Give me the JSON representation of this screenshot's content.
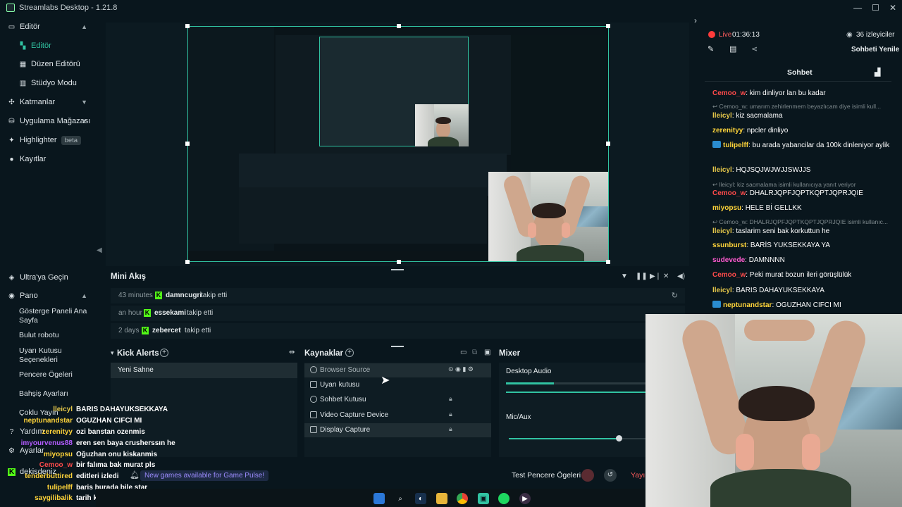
{
  "titlebar": {
    "title": "Streamlabs Desktop - 1.21.8",
    "minimize": "—",
    "maximize": "☐",
    "close": "✕"
  },
  "sidebar": {
    "editor_group": "Editör",
    "editor_items": [
      "Editör",
      "Düzen Editörü",
      "Stüdyo Modu"
    ],
    "layers": "Katmanlar",
    "store": "Uygulama Mağazası",
    "highlighter": "Highlighter",
    "highlighter_badge": "beta",
    "recordings": "Kayıtlar",
    "ultra": "Ultra'ya Geçin",
    "dashboard": "Pano",
    "dashboard_items": [
      "Gösterge Paneli Ana Sayfa",
      "Bulut robotu",
      "Uyarı Kutusu Seçenekleri",
      "Pencere Ögeleri",
      "Bahşiş Ayarları",
      "Çoklu Yayın"
    ],
    "help": "Yardım",
    "settings": "Ayarlar",
    "user": "dekisdeniz"
  },
  "chat": {
    "live_label": "Live",
    "live_time": "01:36:13",
    "viewers": "36 izleyiciler",
    "refresh_label": "Sohbeti Yenile",
    "header": "Sohbet",
    "messages": [
      {
        "user": "Cemoo_w",
        "color": "#ff4b4b",
        "text": "kim dinliyor lan bu kadar",
        "badge": false,
        "muted": false
      },
      {
        "user": "",
        "color": "#7f8a8e",
        "text": "Cemoo_w: umarım zehirlenmem beyazlıcam diye isimli kull...",
        "badge": false,
        "muted": true
      },
      {
        "user": "lleicyl",
        "color": "#e6c84a",
        "text": "kiz sacmalama",
        "badge": false,
        "muted": false
      },
      {
        "user": "zerenityy",
        "color": "#ffd43a",
        "text": "npcler dinliyo",
        "badge": false,
        "muted": false
      },
      {
        "user": "tulipelff",
        "color": "#ffd43a",
        "text": "bu arada yabancilar da 100k dinleniyor aylik",
        "badge": true,
        "muted": false
      },
      {
        "user": "lleicyl",
        "color": "#e6c84a",
        "text": "HQJSQJWJWJJSWJJS",
        "badge": false,
        "muted": false
      },
      {
        "user": "",
        "color": "#7f8a8e",
        "text": "lleicyl: kiz sacmalama isimli kullanıcıya yanıt veriyor",
        "badge": false,
        "muted": true
      },
      {
        "user": "Cemoo_w",
        "color": "#ff4b4b",
        "text": "DHALRJQPFJQPTKQPTJQPRJQIE",
        "badge": false,
        "muted": false
      },
      {
        "user": "miyopsu",
        "color": "#ffd43a",
        "text": "HELE Bİ GELLKK",
        "badge": false,
        "muted": false
      },
      {
        "user": "",
        "color": "#7f8a8e",
        "text": "Cemoo_w: DHALRJQPFJQPTKQPTJQPRJQIE isimli kullanıc...",
        "badge": false,
        "muted": true
      },
      {
        "user": "lleicyl",
        "color": "#e6c84a",
        "text": "taslarim seni bak korkuttun he",
        "badge": false,
        "muted": false
      },
      {
        "user": "ssunburst",
        "color": "#ffd43a",
        "text": "BARİS YUKSEKKAYA YA",
        "badge": false,
        "muted": false
      },
      {
        "user": "sudevede",
        "color": "#ff5bd0",
        "text": "DAMNNNN",
        "badge": false,
        "muted": false
      },
      {
        "user": "Cemoo_w",
        "color": "#ff4b4b",
        "text": "Peki murat bozun ileri görüşlülük",
        "badge": false,
        "muted": false
      },
      {
        "user": "lleicyl",
        "color": "#e6c84a",
        "text": "BARIS DAHAYUKSEKKAYA",
        "badge": false,
        "muted": false
      },
      {
        "user": "neptunandstar",
        "color": "#ffd43a",
        "text": "OGUZHAN CIFCI MI",
        "badge": true,
        "muted": false
      }
    ]
  },
  "minifeed": {
    "title": "Mini Akış",
    "rows": [
      {
        "time": "43 minutes",
        "user": "damncugri",
        "action": "takip etti"
      },
      {
        "time": "an hour",
        "user": "essekami",
        "action": "takip etti"
      },
      {
        "time": "2 days",
        "user": "zebercet",
        "action": "takip etti"
      }
    ]
  },
  "scenes": {
    "title": "Kick Alerts",
    "items": [
      "Yeni Sahne"
    ]
  },
  "sources": {
    "title": "Kaynaklar",
    "items": [
      "Browser Source",
      "Uyarı kutusu",
      "Sohbet Kutusu",
      "Video Capture Device",
      "Display Capture"
    ]
  },
  "mixer": {
    "title": "Mixer",
    "channels": [
      "Desktop Audio",
      "Mic/Aux"
    ]
  },
  "footer": {
    "notification": "New games available for Game Pulse!",
    "test_label": "Test Pencere Ögeleri",
    "go_live": "Yayın"
  },
  "overlay_chat": [
    {
      "user": "lleicyl",
      "color": "#e6c84a",
      "text": "BARIS DAHAYUKSEKKAYA"
    },
    {
      "user": "neptunandstar",
      "color": "#ffd43a",
      "text": "OGUZHAN CIFCI MI"
    },
    {
      "user": "zerenityy",
      "color": "#ffd43a",
      "text": "ozi banstan ozenmis"
    },
    {
      "user": "imyourvenus88",
      "color": "#b45cff",
      "text": "eren sen baya crusherssın he"
    },
    {
      "user": "miyopsu",
      "color": "#ffd43a",
      "text": "Oğuzhan onu kiskanmis"
    },
    {
      "user": "Cemoo_w",
      "color": "#ff4b4b",
      "text": "bir falıma bak murat pls"
    },
    {
      "user": "tenderbuttired",
      "color": "#ffd43a",
      "text": "editleri izledi"
    },
    {
      "user": "tulipelff",
      "color": "#ffd43a",
      "text": "baris burada bile star"
    },
    {
      "user": "saygilibalik",
      "color": "#ffd43a",
      "text": "tarih kendini tekrarlıyo"
    }
  ],
  "colors": {
    "accent": "#31c3a2",
    "bg": "#09161d",
    "panel": "#0e1c23",
    "kick": "#53fc18"
  }
}
